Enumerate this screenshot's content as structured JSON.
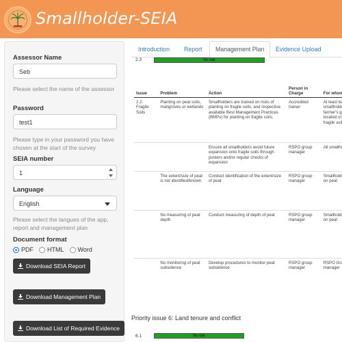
{
  "app": {
    "title": "Smallholder-SEIA"
  },
  "sidebar": {
    "assessor_label": "Assessor Name",
    "assessor_value": "Seb",
    "assessor_help": "Please select the name of the assessor",
    "password_label": "Password",
    "password_value": "test1",
    "password_help": "Please type in your password you have chosen at the start of the survey",
    "seia_label": "SEIA number",
    "seia_value": "1",
    "language_label": "Language",
    "language_value": "English",
    "language_help": "Please select the langues of the app, report and management plan",
    "format_label": "Document format",
    "formats": [
      {
        "label": "PDF",
        "selected": true
      },
      {
        "label": "HTML",
        "selected": false
      },
      {
        "label": "Word",
        "selected": false
      }
    ],
    "btn_report": "Download SEIA Report",
    "btn_plan": "Download Management Plan",
    "btn_evidence": "Download List of Required Evidence"
  },
  "tabs": [
    "Introduction",
    "Report",
    "Management Plan",
    "Evidence Upload"
  ],
  "active_tab": "Management Plan",
  "plan": {
    "top_row": {
      "num": "2.3",
      "risk": "No risk"
    },
    "headers": [
      "Issue",
      "Problem",
      "Action",
      "Person in Charge",
      "For whom?"
    ],
    "rows": [
      {
        "issue": "2.2: Fragile Soils",
        "problem": "Planting on peat soils, mangroves or wetlands",
        "action": "Smallholders are trained on risks of planting on fragile soils; and respective available Best Management Practices (BMPs) for planting on fragile soils.",
        "person": "Accredited trainer",
        "whom": "At least two smallholders per farmer's group located on or near fragile soils"
      },
      {
        "issue": "",
        "problem": "",
        "action": "Ensure all smallholders avoid future expansion onto fragile soils through posters and/or regular checks of expansion",
        "person": "RSPO group manager",
        "whom": "All smallholders"
      },
      {
        "issue": "",
        "problem": "The extent/size of peat is not identified/known",
        "action": "Conduct identification of the extent/size of peat",
        "person": "RSPO group manager",
        "whom": "Smallholders located on peat"
      },
      {
        "issue": "",
        "problem": "No measuring of peat depth",
        "action": "Conduct measuring of depth of peat",
        "person": "RSPO group manager",
        "whom": "Smallholders located on peat"
      },
      {
        "issue": "",
        "problem": "No monitoring of peat subsidence",
        "action": "Develop procedures to monitor peat subsidence",
        "person": "RSPO group manager",
        "whom": "RSPO Group manager"
      }
    ],
    "priority_title": "Priority issue 6: Land tenure and conflict",
    "bottom_row": {
      "num": "6.1",
      "risk": "No risk"
    }
  },
  "colors": {
    "header": "#f39654",
    "risk_green": "#1fa023",
    "button": "#3a3a3a",
    "link": "#337ab7"
  }
}
